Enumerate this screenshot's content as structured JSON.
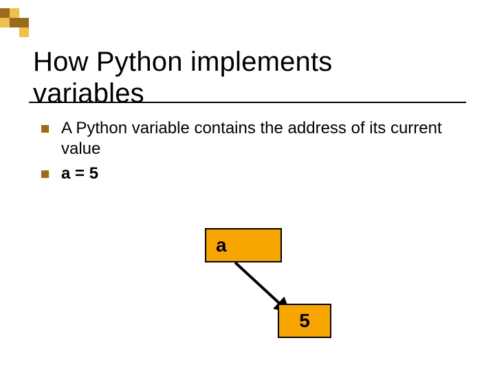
{
  "title_line1": "How Python implements",
  "title_line2": "variables",
  "bullets": [
    "A Python variable contains the address of its current value",
    "a = 5"
  ],
  "diagram": {
    "var_box_label": "a",
    "value_box_label": "5"
  },
  "colors": {
    "accent_orange": "#f7a600",
    "bullet_brown": "#9a6a1e",
    "deco_dark": "#9a6a1e",
    "deco_light": "#f2c04a"
  }
}
